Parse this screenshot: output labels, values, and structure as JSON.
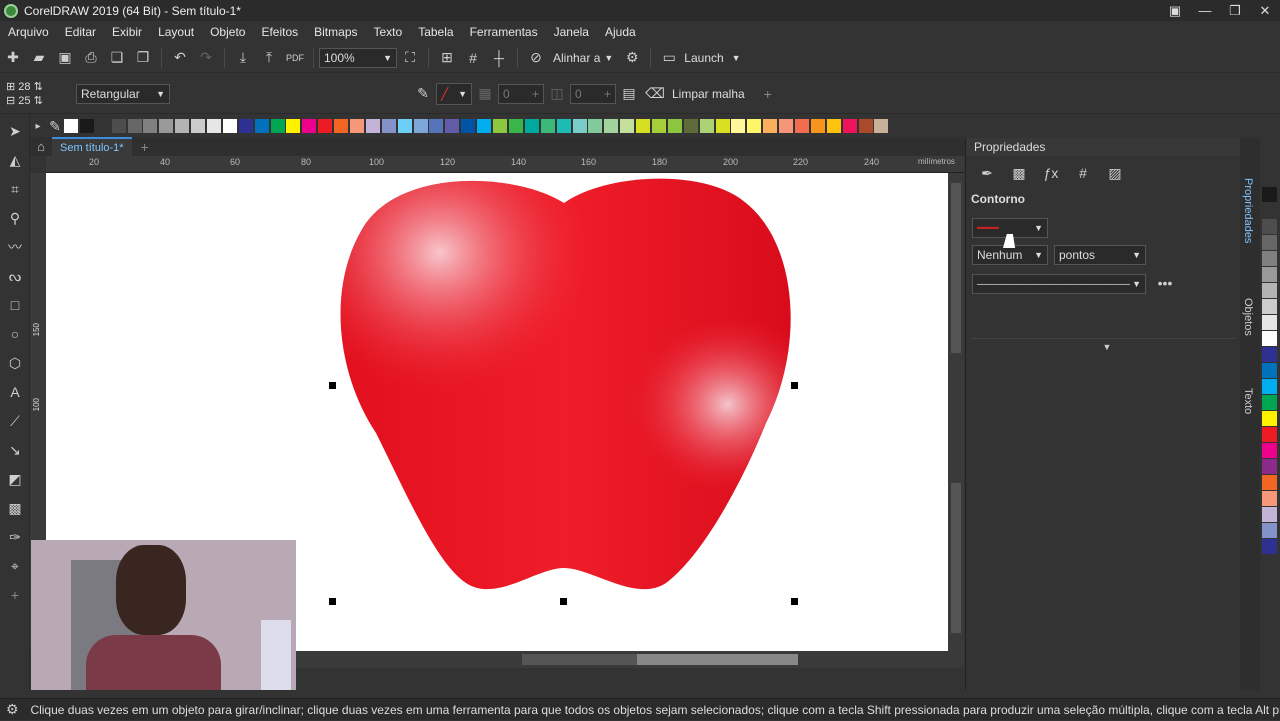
{
  "window": {
    "title": "CorelDRAW 2019 (64 Bit) - Sem título-1*"
  },
  "menu": [
    "Arquivo",
    "Editar",
    "Exibir",
    "Layout",
    "Objeto",
    "Efeitos",
    "Bitmaps",
    "Texto",
    "Tabela",
    "Ferramentas",
    "Janela",
    "Ajuda"
  ],
  "toolbar": {
    "zoom": "100%",
    "align_label": "Alinhar a",
    "launch_label": "Launch"
  },
  "propbar": {
    "grid_cols": "28",
    "grid_rows": "25",
    "mode": "Retangular",
    "val1": "0",
    "val2": "0",
    "clear_mesh": "Limpar malha"
  },
  "document": {
    "tab": "Sem título-1*"
  },
  "ruler": {
    "units": "milímetros",
    "ticks": [
      "20",
      "40",
      "60",
      "80",
      "100",
      "120",
      "140",
      "160",
      "180",
      "200",
      "220",
      "240"
    ],
    "vticks": [
      "150",
      "120",
      "100"
    ]
  },
  "panel": {
    "title": "Propriedades",
    "section": "Contorno",
    "width_value": "Nenhum",
    "width_units": "pontos"
  },
  "sidetabs": {
    "props": "Propriedades",
    "objects": "Objetos",
    "text": "Texto"
  },
  "status": {
    "text": "Clique duas vezes em um objeto para girar/inclinar; clique duas vezes em uma ferramenta para que todos os objetos sejam selecionados; clique com a tecla Shift pressionada para produzir uma seleção múltipla, clique com a tecla Alt pressionada para p"
  },
  "colors": {
    "palette": [
      "#ffffff",
      "#1a1a1a",
      "#333333",
      "#4d4d4d",
      "#666666",
      "#808080",
      "#999999",
      "#b3b3b3",
      "#cccccc",
      "#e6e6e6",
      "#ffffff",
      "#2e3192",
      "#0072bc",
      "#00a651",
      "#fff200",
      "#ec008c",
      "#ed1c24",
      "#f26522",
      "#f7977a",
      "#c4b3d8",
      "#8393ca",
      "#6dcff6",
      "#7da7d9",
      "#5674b9",
      "#605ca8",
      "#0054a6",
      "#00aeef",
      "#8dc63f",
      "#39b54a",
      "#00a99d",
      "#3cb878",
      "#1cbbb4",
      "#7accc8",
      "#82ca9c",
      "#a3d39c",
      "#c4df9b",
      "#d7df23",
      "#a6ce39",
      "#8cc63f",
      "#606b3a",
      "#acd373",
      "#d9e021",
      "#fff799",
      "#fff568",
      "#fbaf5d",
      "#f69679",
      "#f26c4f",
      "#f7941d",
      "#ffc20e",
      "#ed145b",
      "#aa4a2a",
      "#c7b299"
    ],
    "vpalette": [
      "#1a1a1a",
      "#333333",
      "#4d4d4d",
      "#666666",
      "#808080",
      "#999999",
      "#b3b3b3",
      "#cccccc",
      "#e6e6e6",
      "#ffffff",
      "#2e3192",
      "#0072bc",
      "#00aeef",
      "#00a651",
      "#fff200",
      "#ed1c24",
      "#ec008c",
      "#8c2a8c",
      "#f26522",
      "#f7977a",
      "#c4b3d8",
      "#8393ca",
      "#2e3192"
    ]
  }
}
